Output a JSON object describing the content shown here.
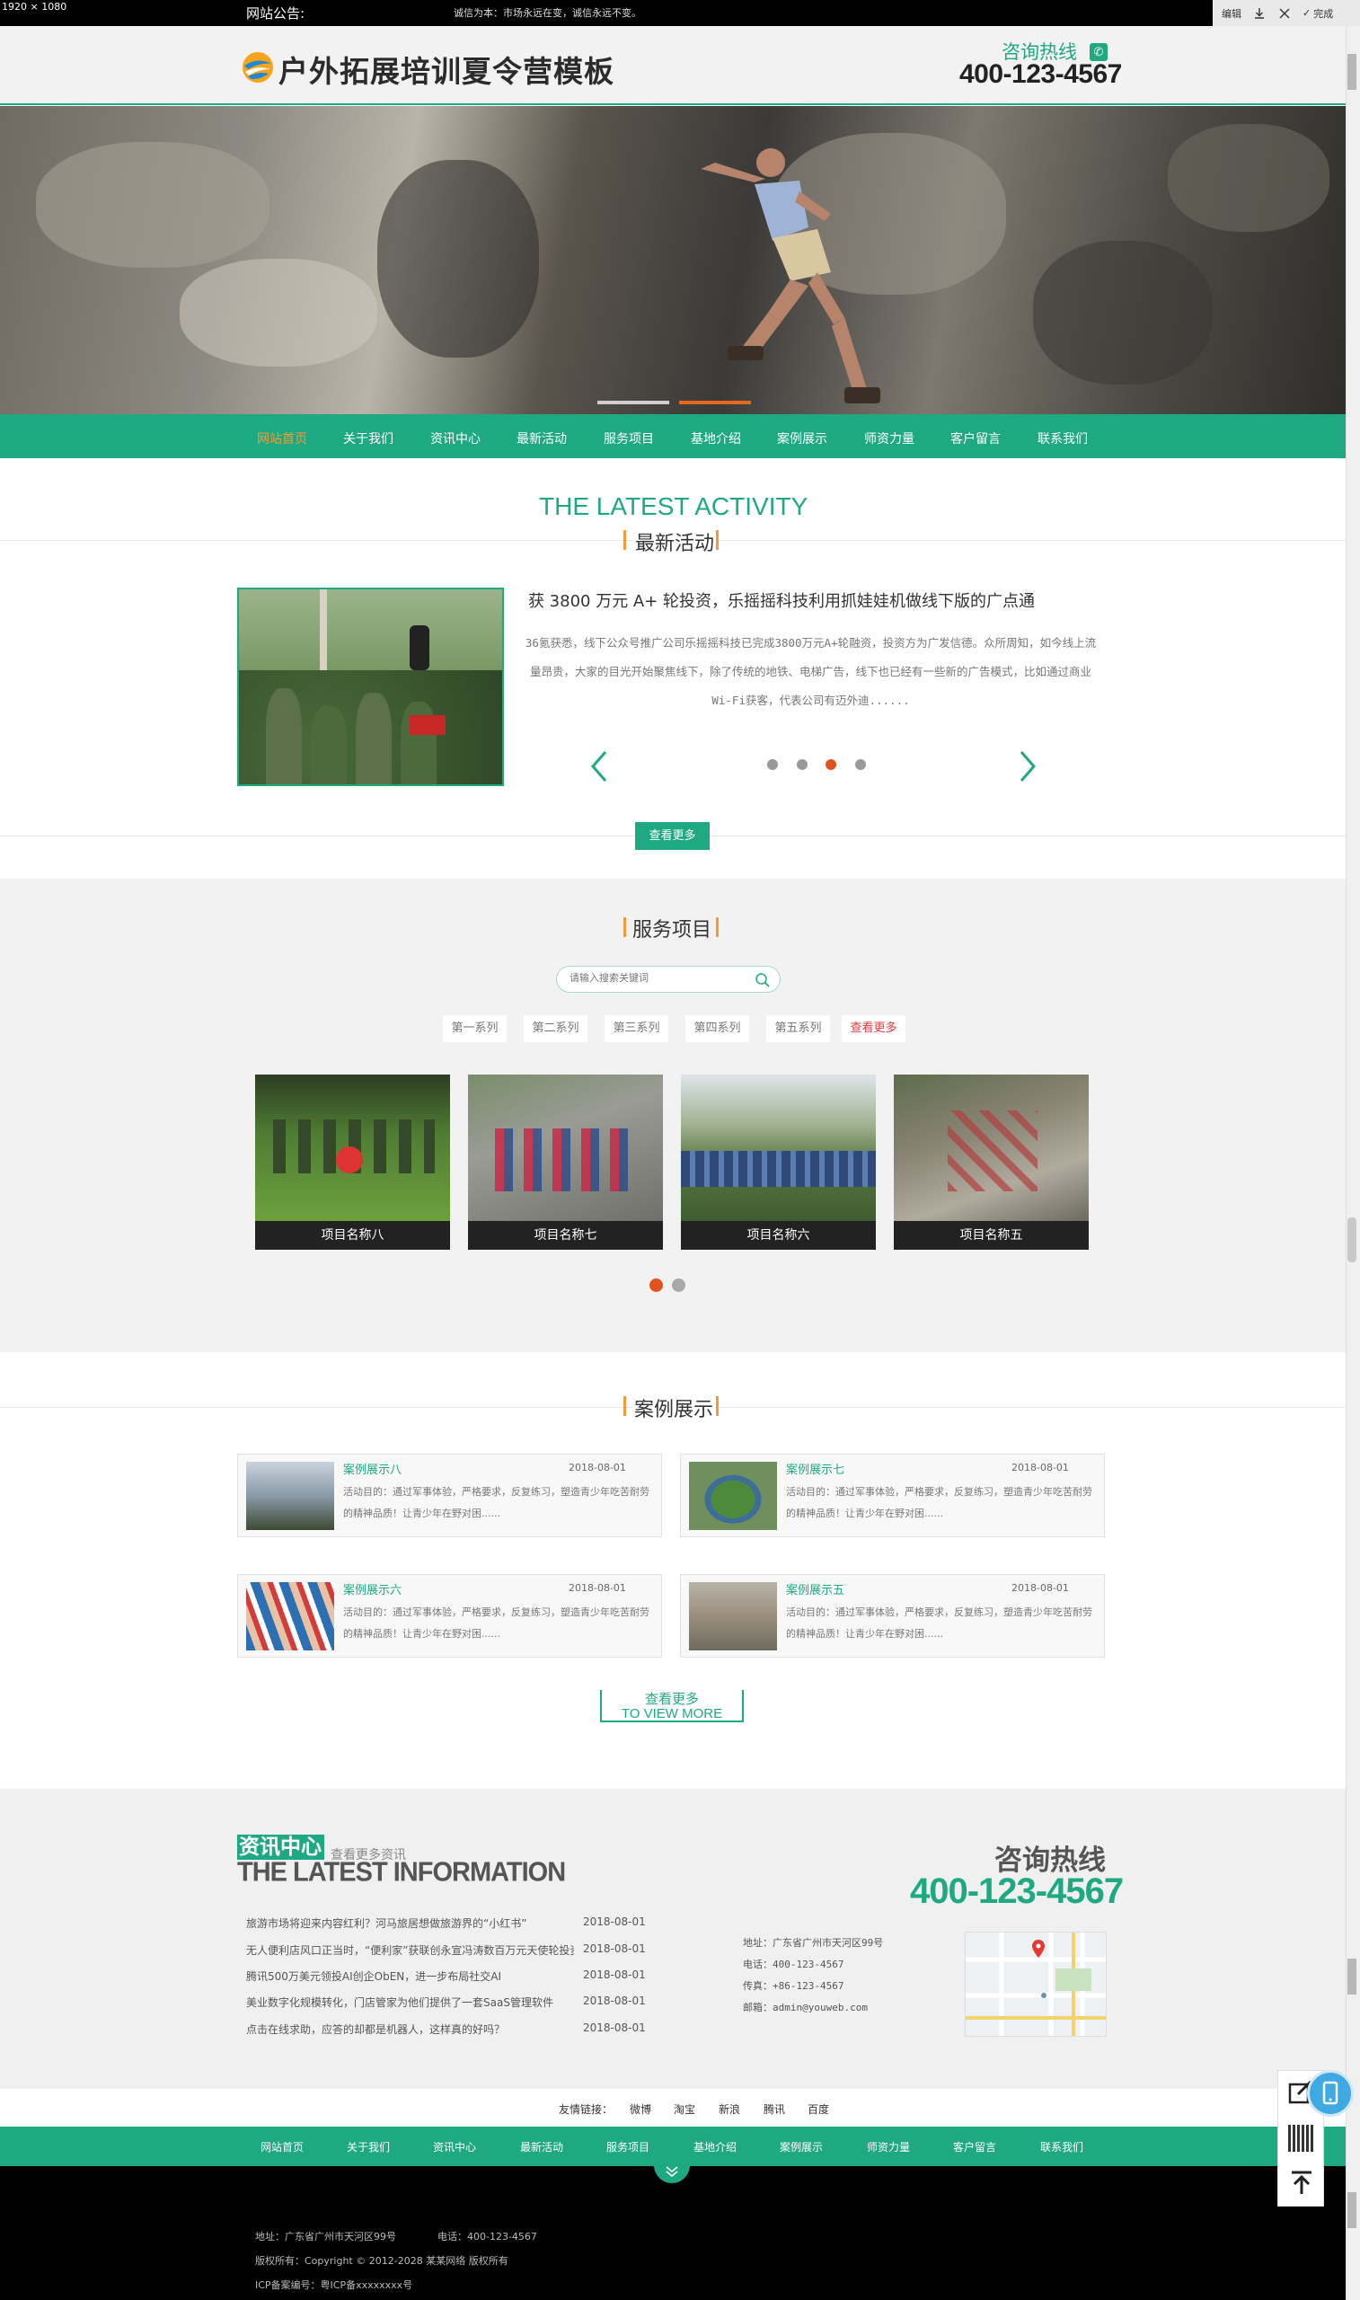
{
  "browser": {
    "dimensions": "1920 × 1080",
    "toolbar": {
      "edit_label": "编辑",
      "done_label": "完成"
    }
  },
  "notice": {
    "label": "网站公告:",
    "text": "诚信为本：市场永远在变，诚信永远不变。"
  },
  "header": {
    "site_title": "户外拓展培训夏令营模板",
    "hotline_label": "咨询热线",
    "hotline_number": "400-123-4567"
  },
  "banner": {
    "slides_total": 2,
    "active_slide": 2
  },
  "nav": {
    "items": [
      "网站首页",
      "关于我们",
      "资讯中心",
      "最新活动",
      "服务项目",
      "基地介绍",
      "案例展示",
      "师资力量",
      "客户留言",
      "联系我们"
    ],
    "active_index": 0
  },
  "activity": {
    "title_en": "THE LATEST ACTIVITY",
    "title_cn": "最新活动",
    "headline": "获 3800 万元 A+ 轮投资，乐摇摇科技利用抓娃娃机做线下版的广点通",
    "body": "36氪获悉，线下公众号推广公司乐摇摇科技已完成3800万元A+轮融资，投资方为广发信德。众所周知，如今线上流量昂贵，大家的目光开始聚焦线下，除了传统的地铁、电梯广告，线下也已经有一些新的广告模式，比如通过商业Wi-Fi获客，代表公司有迈外迪......",
    "dots_total": 4,
    "active_dot": 3,
    "more_label": "查看更多"
  },
  "services": {
    "title_cn": "服务项目",
    "search_placeholder": "请输入搜索关键词",
    "tabs": [
      "第一系列",
      "第二系列",
      "第三系列",
      "第四系列",
      "第五系列",
      "查看更多"
    ],
    "items": [
      "项目名称八",
      "项目名称七",
      "项目名称六",
      "项目名称五"
    ],
    "dots_total": 2,
    "active_dot": 1
  },
  "cases": {
    "title_cn": "案例展示",
    "items": [
      {
        "title": "案例展示八",
        "date": "2018-08-01",
        "desc": "活动目的：通过军事体验，严格要求，反复练习，塑造青少年吃苦耐劳的精神品质！让青少年在野对困......"
      },
      {
        "title": "案例展示七",
        "date": "2018-08-01",
        "desc": "活动目的：通过军事体验，严格要求，反复练习，塑造青少年吃苦耐劳的精神品质！让青少年在野对困......"
      },
      {
        "title": "案例展示六",
        "date": "2018-08-01",
        "desc": "活动目的：通过军事体验，严格要求，反复练习，塑造青少年吃苦耐劳的精神品质！让青少年在野对困......"
      },
      {
        "title": "案例展示五",
        "date": "2018-08-01",
        "desc": "活动目的：通过军事体验，严格要求，反复练习，塑造青少年吃苦耐劳的精神品质！让青少年在野对困......"
      }
    ],
    "more_cn": "查看更多",
    "more_en": "TO VIEW MORE"
  },
  "info": {
    "title_cn": "资讯中心",
    "more_label": "查看更多资讯",
    "title_en": "THE LATEST INFORMATION",
    "news": [
      {
        "title": "旅游市场将迎来内容红利？河马旅居想做旅游界的“小红书”",
        "date": "2018-08-01"
      },
      {
        "title": "无人便利店风口正当时，“便利家”获联创永宣冯涛数百万元天使轮投资",
        "date": "2018-08-01"
      },
      {
        "title": "腾讯500万美元领投AI创企ObEN，进一步布局社交AI",
        "date": "2018-08-01"
      },
      {
        "title": "美业数字化规模转化，门店管家为他们提供了一套SaaS管理软件",
        "date": "2018-08-01"
      },
      {
        "title": "点击在线求助，应答的却都是机器人，这样真的好吗？",
        "date": "2018-08-01"
      }
    ],
    "hotline_label": "咨询热线",
    "hotline_number": "400-123-4567",
    "contact": {
      "address": "地址：广东省广州市天河区99号",
      "phone": "电话：400-123-4567",
      "fax": "传真：+86-123-4567",
      "email": "邮箱：admin@youweb.com"
    }
  },
  "links": {
    "label": "友情链接：",
    "items": [
      "微博",
      "淘宝",
      "新浪",
      "腾讯",
      "百度"
    ]
  },
  "footer": {
    "nav": [
      "网站首页",
      "关于我们",
      "资讯中心",
      "最新活动",
      "服务项目",
      "基地介绍",
      "案例展示",
      "师资力量",
      "客户留言",
      "联系我们"
    ],
    "address": "地址：广东省广州市天河区99号",
    "phone": "电话：400-123-4567",
    "copyright": "版权所有：Copyright © 2012-2028 某某网络 版权所有",
    "icp": "ICP备案编号：粤ICP备xxxxxxxx号"
  },
  "colors": {
    "brand": "#1fa982",
    "accent": "#f29b38",
    "active_dot": "#e26a1d"
  }
}
